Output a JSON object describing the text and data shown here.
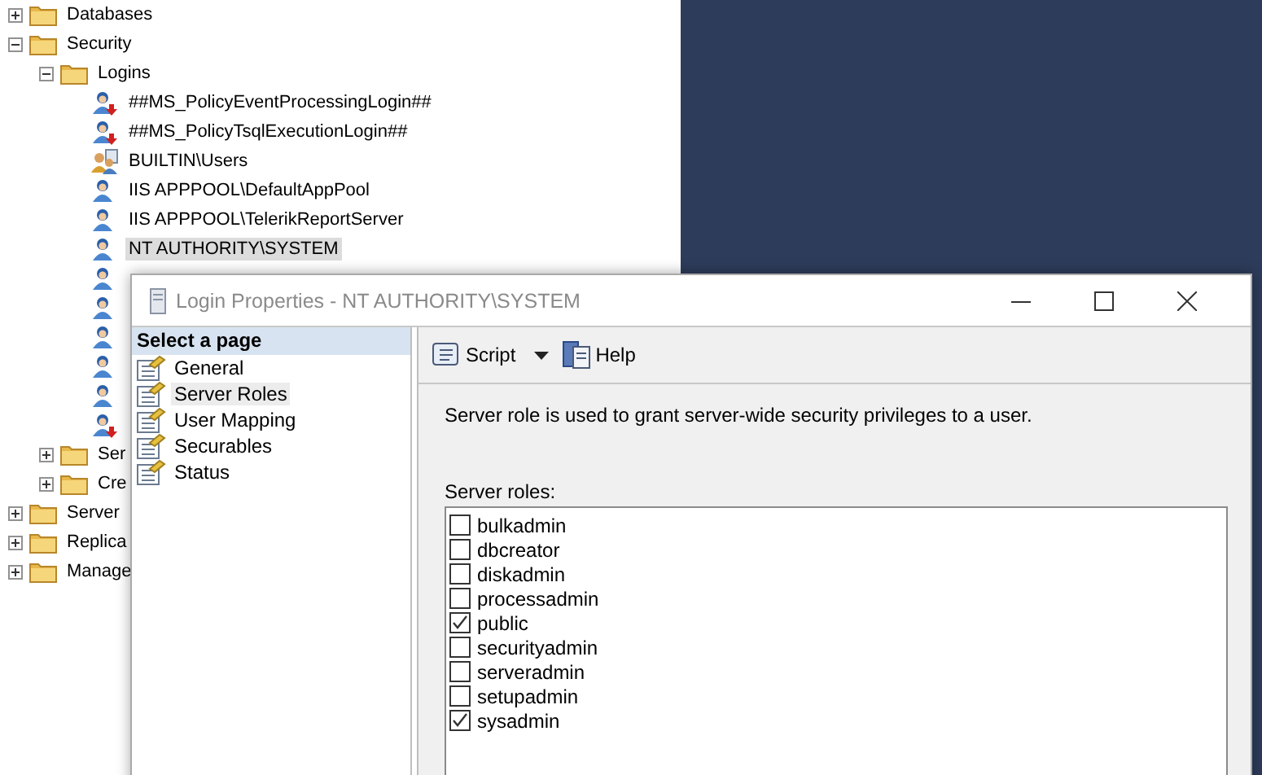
{
  "tree": [
    {
      "label": "Databases",
      "kind": "folder",
      "expanded": false
    },
    {
      "label": "Security",
      "kind": "folder",
      "expanded": true,
      "children": [
        {
          "label": "Logins",
          "kind": "folder",
          "expanded": true,
          "children": [
            {
              "label": "##MS_PolicyEventProcessingLogin##",
              "kind": "login_disabled",
              "selected": false
            },
            {
              "label": "##MS_PolicyTsqlExecutionLogin##",
              "kind": "login_disabled",
              "selected": false
            },
            {
              "label": "BUILTIN\\Users",
              "kind": "group",
              "selected": false
            },
            {
              "label": "IIS APPPOOL\\DefaultAppPool",
              "kind": "login",
              "selected": false
            },
            {
              "label": "IIS APPPOOL\\TelerikReportServer",
              "kind": "login",
              "selected": false
            },
            {
              "label": "NT AUTHORITY\\SYSTEM",
              "kind": "login",
              "selected": true
            },
            {
              "kind": "login",
              "selected": false
            },
            {
              "kind": "login",
              "selected": false
            },
            {
              "kind": "login",
              "selected": false
            },
            {
              "kind": "login",
              "selected": false
            },
            {
              "kind": "login",
              "selected": false
            },
            {
              "kind": "login_disabled",
              "selected": false
            }
          ]
        },
        {
          "label": "Ser",
          "kind": "folder",
          "expanded": false
        },
        {
          "label": "Cre",
          "kind": "folder",
          "expanded": false
        }
      ]
    },
    {
      "label": "Server",
      "kind": "folder",
      "expanded": false
    },
    {
      "label": "Replica",
      "kind": "folder",
      "expanded": false
    },
    {
      "label": "Manage",
      "kind": "folder",
      "expanded": false
    }
  ],
  "dialog": {
    "title": "Login Properties - NT AUTHORITY\\SYSTEM",
    "page_header": "Select a page",
    "pages": [
      {
        "label": "General",
        "selected": false
      },
      {
        "label": "Server Roles",
        "selected": true
      },
      {
        "label": "User Mapping",
        "selected": false
      },
      {
        "label": "Securables",
        "selected": false
      },
      {
        "label": "Status",
        "selected": false
      }
    ],
    "toolbar": [
      {
        "label": "Script",
        "kind": "script"
      },
      {
        "label": "Help",
        "kind": "help"
      }
    ],
    "description": "Server role is used to grant server-wide security privileges to a user.",
    "roles_label": "Server roles:",
    "roles": [
      {
        "label": "bulkadmin",
        "checked": false
      },
      {
        "label": "dbcreator",
        "checked": false
      },
      {
        "label": "diskadmin",
        "checked": false
      },
      {
        "label": "processadmin",
        "checked": false
      },
      {
        "label": "public",
        "checked": true
      },
      {
        "label": "securityadmin",
        "checked": false
      },
      {
        "label": "serveradmin",
        "checked": false
      },
      {
        "label": "setupadmin",
        "checked": false
      },
      {
        "label": "sysadmin",
        "checked": true
      }
    ]
  }
}
